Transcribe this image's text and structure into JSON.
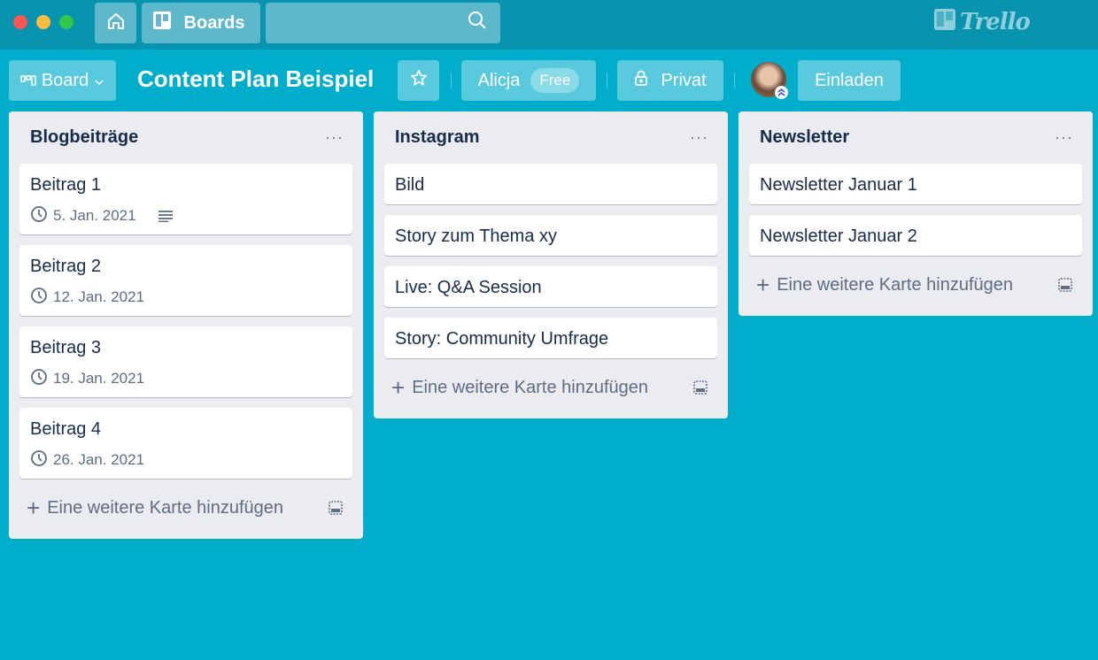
{
  "window": {
    "controls": [
      "close",
      "minimize",
      "maximize"
    ]
  },
  "topbar": {
    "home_icon": "home-icon",
    "boards_label": "Boards",
    "boards_icon": "boards-icon",
    "search_placeholder": "",
    "search_icon": "search-icon",
    "logo_text": "Trello"
  },
  "board_header": {
    "view_switch_label": "Board",
    "board_title": "Content Plan Beispiel",
    "star_icon": "star-icon",
    "team_label": "Alicja",
    "team_badge": "Free",
    "privacy_label": "Privat",
    "privacy_icon": "lock-icon",
    "invite_label": "Einladen"
  },
  "lists": [
    {
      "title": "Blogbeiträge",
      "menu": "···",
      "cards": [
        {
          "title": "Beitrag 1",
          "due": "5. Jan. 2021",
          "has_description": true
        },
        {
          "title": "Beitrag 2",
          "due": "12. Jan. 2021",
          "has_description": false
        },
        {
          "title": "Beitrag 3",
          "due": "19. Jan. 2021",
          "has_description": false
        },
        {
          "title": "Beitrag 4",
          "due": "26. Jan. 2021",
          "has_description": false
        }
      ],
      "add_card_label": "Eine weitere Karte hinzufügen"
    },
    {
      "title": "Instagram",
      "menu": "···",
      "cards": [
        {
          "title": "Bild"
        },
        {
          "title": "Story zum Thema xy"
        },
        {
          "title": "Live: Q&A Session"
        },
        {
          "title": "Story: Community Umfrage"
        }
      ],
      "add_card_label": "Eine weitere Karte hinzufügen"
    },
    {
      "title": "Newsletter",
      "menu": "···",
      "cards": [
        {
          "title": "Newsletter Januar 1"
        },
        {
          "title": "Newsletter Januar 2"
        }
      ],
      "add_card_label": "Eine weitere Karte hinzufügen"
    }
  ],
  "colors": {
    "board_background": "#00aecc",
    "topbar_background": "#0893af",
    "list_background": "#ebecf0",
    "text_primary": "#172b4d",
    "text_muted": "#5e6c84"
  }
}
